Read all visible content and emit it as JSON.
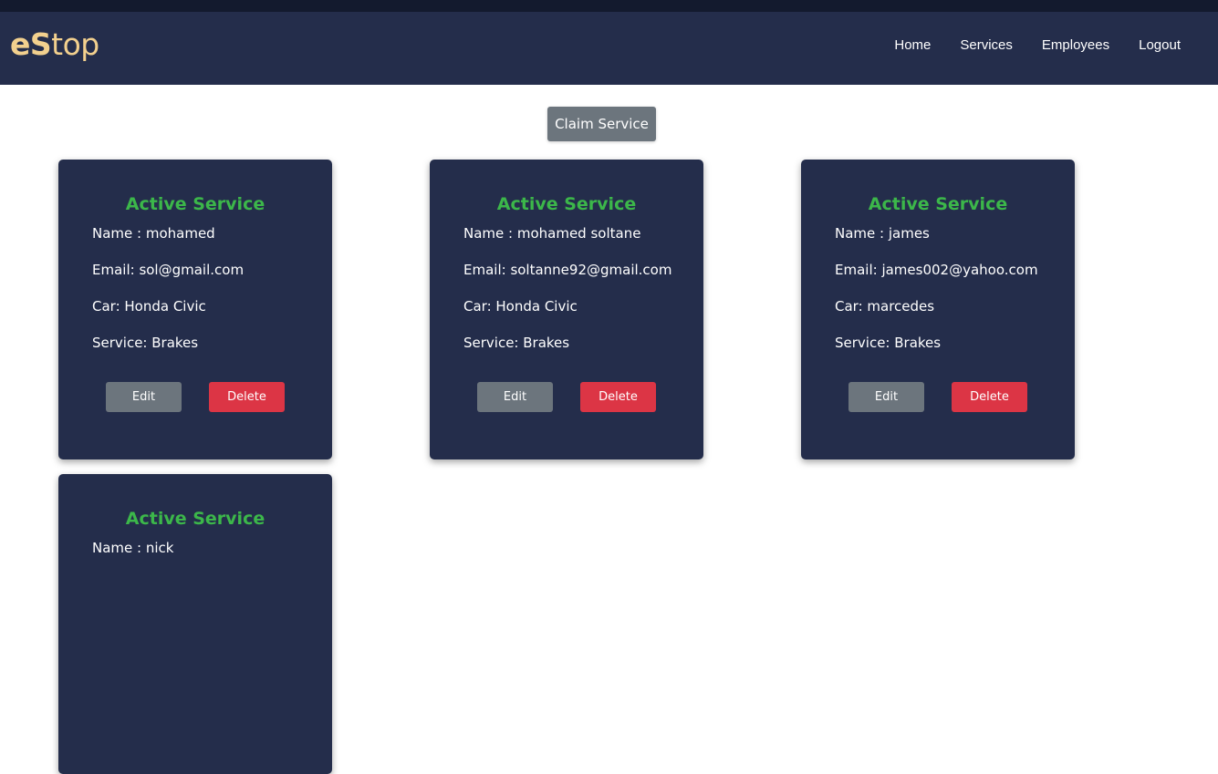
{
  "brand": {
    "logo_bold": "eS",
    "logo_rest": "top"
  },
  "nav": {
    "items": [
      {
        "label": "Home"
      },
      {
        "label": "Services"
      },
      {
        "label": "Employees"
      },
      {
        "label": "Logout"
      }
    ]
  },
  "main": {
    "claim_button": "Claim Service",
    "cards": [
      {
        "title": "Active Service",
        "name": "Name : mohamed",
        "email": "Email: sol@gmail.com",
        "car": "Car: Honda Civic",
        "service": "Service: Brakes",
        "edit_label": "Edit",
        "delete_label": "Delete"
      },
      {
        "title": "Active Service",
        "name": "Name : mohamed soltane",
        "email": "Email: soltanne92@gmail.com",
        "car": "Car: Honda Civic",
        "service": "Service: Brakes",
        "edit_label": "Edit",
        "delete_label": "Delete"
      },
      {
        "title": "Active Service",
        "name": "Name : james",
        "email": "Email: james002@yahoo.com",
        "car": "Car: marcedes",
        "service": "Service: Brakes",
        "edit_label": "Edit",
        "delete_label": "Delete"
      },
      {
        "title": "Active Service",
        "name": "Name : nick"
      }
    ]
  },
  "colors": {
    "navbar": "#242d4b",
    "topstrip": "#131a2e",
    "logo": "#f2d08e",
    "card_bg": "#242d4b",
    "card_title": "#3cb74a",
    "edit_button": "#6c757d",
    "delete_button": "#dc3545",
    "claim_button": "#6c757d"
  }
}
